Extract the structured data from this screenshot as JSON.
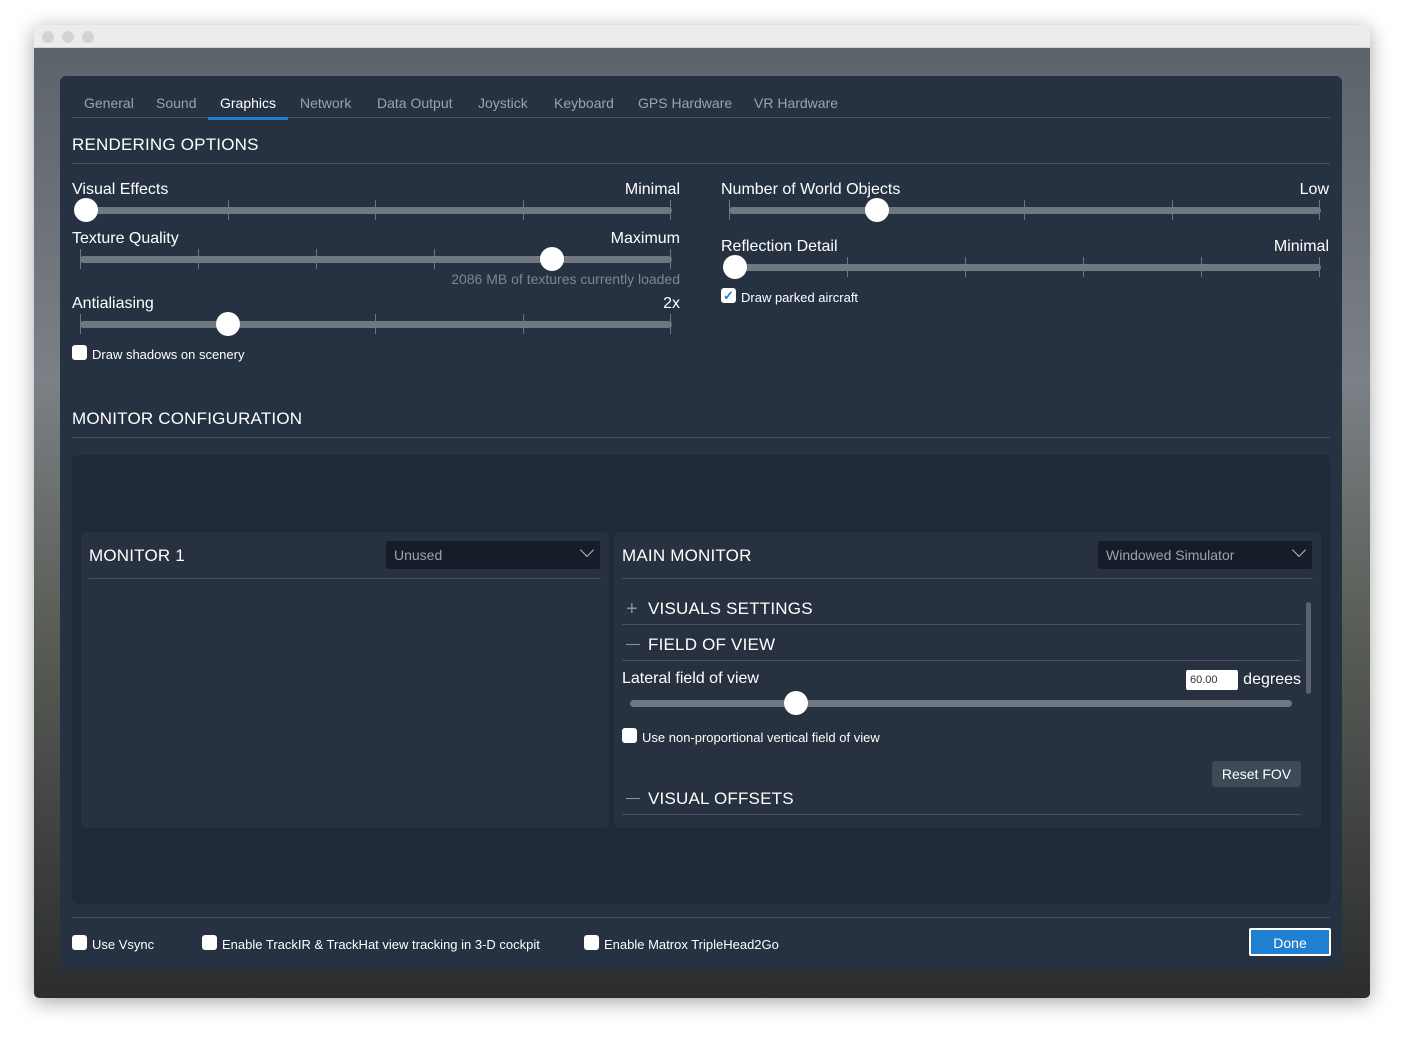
{
  "tabs": [
    "General",
    "Sound",
    "Graphics",
    "Network",
    "Data Output",
    "Joystick",
    "Keyboard",
    "GPS Hardware",
    "VR Hardware"
  ],
  "active_tab": "Graphics",
  "rendering": {
    "title": "RENDERING OPTIONS",
    "visual_effects": {
      "label": "Visual Effects",
      "value": "Minimal",
      "position": 0,
      "steps": 5
    },
    "texture_quality": {
      "label": "Texture Quality",
      "value": "Maximum",
      "position": 4,
      "steps": 6,
      "note": "2086 MB of textures currently loaded"
    },
    "antialiasing": {
      "label": "Antialiasing",
      "value": "2x",
      "position": 1,
      "steps": 5
    },
    "draw_shadows": {
      "label": "Draw shadows on scenery",
      "checked": false
    },
    "world_objects": {
      "label": "Number of World Objects",
      "value": "Low",
      "position": 1,
      "steps": 5
    },
    "reflection_detail": {
      "label": "Reflection Detail",
      "value": "Minimal",
      "position": 0,
      "steps": 6
    },
    "parked_aircraft": {
      "label": "Draw parked aircraft",
      "checked": true
    }
  },
  "monitor": {
    "title": "MONITOR CONFIGURATION",
    "monitor1": {
      "title": "MONITOR 1",
      "select": "Unused"
    },
    "main": {
      "title": "MAIN MONITOR",
      "select": "Windowed Simulator",
      "visuals_settings": "VISUALS SETTINGS",
      "field_of_view": "FIELD OF VIEW",
      "lateral_label": "Lateral field of view",
      "lateral_value": "60.00",
      "units": "degrees",
      "lateral_fraction": 0.25,
      "nonprop": {
        "label": "Use non-proportional vertical field of view",
        "checked": false
      },
      "reset": "Reset FOV",
      "visual_offsets": "VISUAL OFFSETS"
    }
  },
  "footer": {
    "vsync": "Use Vsync",
    "trackir": "Enable TrackIR & TrackHat view tracking in 3-D cockpit",
    "matrox": "Enable Matrox TripleHead2Go",
    "done": "Done"
  },
  "colors": {
    "accent": "#1f7fd0",
    "panel": "#263141"
  }
}
